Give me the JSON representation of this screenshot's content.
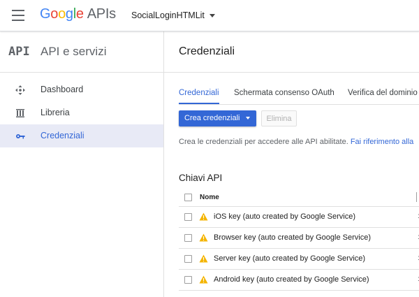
{
  "header": {
    "brand": {
      "letters": [
        "G",
        "o",
        "o",
        "g",
        "l",
        "e"
      ],
      "suffix": "APIs"
    },
    "project": "SocialLoginHTMLit"
  },
  "sidebar": {
    "icon_text": "API",
    "title": "API e servizi",
    "items": [
      {
        "label": "Dashboard",
        "icon": "dashboard-icon",
        "active": false
      },
      {
        "label": "Libreria",
        "icon": "library-icon",
        "active": false
      },
      {
        "label": "Credenziali",
        "icon": "key-icon",
        "active": true
      }
    ]
  },
  "main": {
    "title": "Credenziali",
    "tabs": [
      {
        "label": "Credenziali",
        "active": true
      },
      {
        "label": "Schermata consenso OAuth",
        "active": false
      },
      {
        "label": "Verifica del dominio",
        "active": false
      }
    ],
    "create_button": "Crea credenziali",
    "delete_button": "Elimina",
    "description": "Crea le credenziali per accedere alle API abilitate.",
    "description_link": "Fai riferimento alla",
    "section_title": "Chiavi API",
    "table": {
      "columns": [
        "Nome"
      ],
      "rows": [
        {
          "name": "iOS key (auto created by Google Service)"
        },
        {
          "name": "Browser key (auto created by Google Service)"
        },
        {
          "name": "Server key (auto created by Google Service)"
        },
        {
          "name": "Android key (auto created by Google Service)"
        }
      ]
    }
  },
  "colors": {
    "accent": "#3367d6",
    "active_nav_bg": "#e8eaf6",
    "warning": "#f4b400"
  }
}
